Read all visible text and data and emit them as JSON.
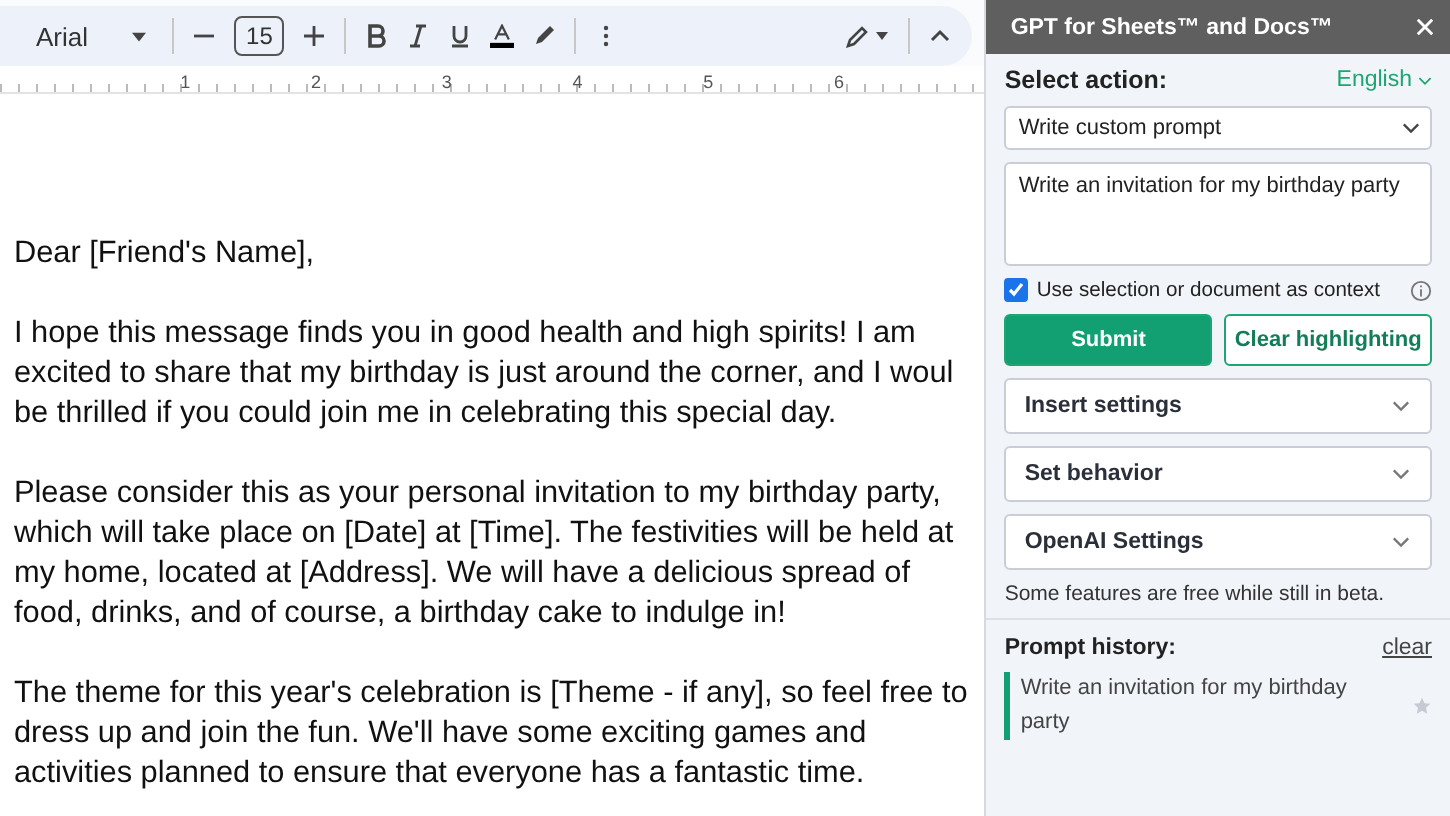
{
  "toolbar": {
    "font": "Arial",
    "font_size": "15"
  },
  "ruler": {
    "marks": [
      "1",
      "2",
      "3",
      "4",
      "5",
      "6"
    ]
  },
  "document": {
    "paragraphs": [
      [
        "Dear [Friend's Name],"
      ],
      [
        "I hope this message finds you in good health and high spirits! I am",
        "excited to share that my birthday is just around the corner, and I woul",
        "be thrilled if you could join me in celebrating this special day."
      ],
      [
        "Please consider this as your personal invitation to my birthday party,",
        "which will take place on [Date] at [Time]. The festivities will be held at",
        "my home, located at [Address]. We will have a delicious spread of",
        "food, drinks, and of course, a birthday cake to indulge in!"
      ],
      [
        "The theme for this year's celebration is [Theme - if any], so feel free to",
        "dress up and join the fun. We'll have some exciting games and",
        "activities planned to ensure that everyone has a fantastic time."
      ]
    ]
  },
  "sidebar": {
    "title": "GPT for Sheets™ and Docs™",
    "select_label": "Select action:",
    "language": "English",
    "action": "Write custom prompt",
    "prompt": "Write an invitation for my birthday party",
    "context_checkbox": {
      "label": "Use selection or document as context",
      "checked": true
    },
    "buttons": [
      "Submit",
      "Clear highlighting"
    ],
    "sections": [
      {
        "label": "Insert settings",
        "expanded": false
      },
      {
        "label": "Set behavior",
        "expanded": false
      },
      {
        "label": "OpenAI Settings",
        "expanded": false
      }
    ],
    "note": "Some features are free while still in beta.",
    "history_label": "Prompt history:",
    "history_clear": "clear",
    "history": [
      {
        "text": "Write an invitation for my birthday party",
        "starred": false
      }
    ]
  }
}
